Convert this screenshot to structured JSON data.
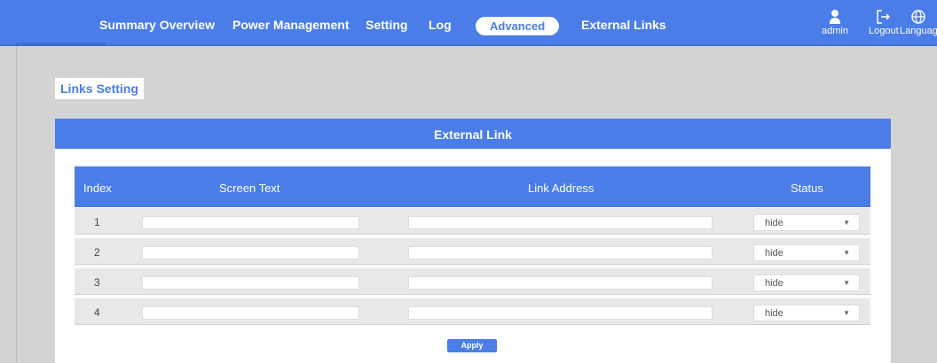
{
  "nav": {
    "items": [
      {
        "label": "Summary Overview"
      },
      {
        "label": "Power Management"
      },
      {
        "label": "Setting"
      },
      {
        "label": "Log"
      },
      {
        "label": "Advanced"
      },
      {
        "label": "External Links"
      }
    ],
    "active_index": 4
  },
  "user_tools": {
    "user": "admin",
    "logout": "Logout",
    "language": "Languag"
  },
  "section_title": "Links Setting",
  "panel": {
    "title": "External Link",
    "columns": [
      "Index",
      "Screen Text",
      "Link Address",
      "Status"
    ],
    "rows": [
      {
        "index": "1",
        "screen_text": "",
        "link_address": "",
        "status": "hide"
      },
      {
        "index": "2",
        "screen_text": "",
        "link_address": "",
        "status": "hide"
      },
      {
        "index": "3",
        "screen_text": "",
        "link_address": "",
        "status": "hide"
      },
      {
        "index": "4",
        "screen_text": "",
        "link_address": "",
        "status": "hide"
      }
    ],
    "apply_label": "Apply"
  },
  "colors": {
    "accent": "#4a7de8",
    "background": "#d3d3d3"
  }
}
